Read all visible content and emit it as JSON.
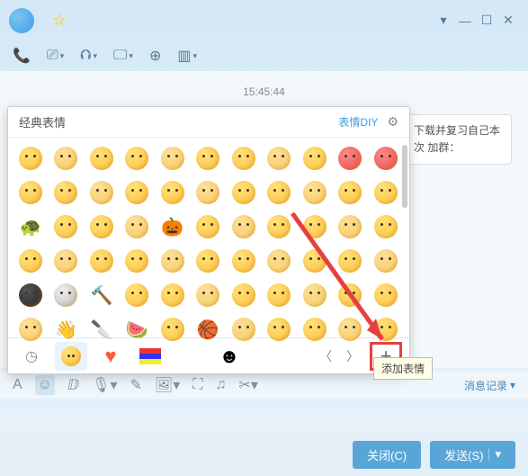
{
  "titlebar": {
    "star": "☆"
  },
  "window_controls": {
    "dropdown": "▾",
    "min": "—",
    "max": "☐",
    "close": "✕"
  },
  "toolbar1": {
    "call": "📞",
    "video": "⎚",
    "share": "⮉",
    "screen": "🖵",
    "add": "⊕",
    "apps": "▥"
  },
  "chat": {
    "timestamp": "15:45:44",
    "message": "下载并复习自己本次\n加群："
  },
  "emoji_panel": {
    "title": "经典表情",
    "diy": "表情DIY",
    "add_tooltip": "添加表情",
    "rows": 6,
    "cols": 11,
    "objects": {
      "22": "🐢",
      "26": "🎃",
      "46": "🔨",
      "56": "👋",
      "57": "🔪",
      "58": "🍉",
      "60": "🏀"
    },
    "special": {
      "9": "red",
      "10": "red",
      "44": "dark",
      "45": "skull"
    }
  },
  "tabs": {
    "items": [
      "clock",
      "smile",
      "heart",
      "flag",
      "blank",
      "ghost"
    ]
  },
  "input_toolbar": {
    "font": "A",
    "emoji": "☺",
    "gif": "ⅅ",
    "mic": "🎙",
    "edit": "✎",
    "image": "🖼",
    "screenshot": "⛶",
    "music": "♫",
    "cut": "✂",
    "history": "消息记录"
  },
  "footer": {
    "close": "关闭(C)",
    "send": "发送(S)"
  }
}
